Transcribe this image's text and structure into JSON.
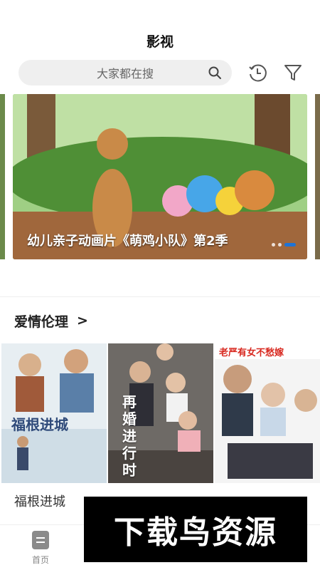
{
  "header": {
    "title": "影视"
  },
  "search": {
    "placeholder": "大家都在搜"
  },
  "banner": {
    "caption": "幼儿亲子动画片《萌鸡小队》第2季",
    "page_count": 3,
    "active_index": 2
  },
  "section": {
    "title": "爱情伦理",
    "arrow": ">"
  },
  "posters": [
    {
      "title": "福根进城",
      "art_text": "福根进城"
    },
    {
      "title": "",
      "art_text": "再婚进行时"
    },
    {
      "title": "",
      "art_text": "老严有女不愁嫁"
    }
  ],
  "bottom_nav": {
    "items": [
      {
        "label": "首页",
        "active": false
      },
      {
        "label": "",
        "active": false
      },
      {
        "label": "",
        "active": true
      },
      {
        "label": "",
        "active": false
      }
    ]
  },
  "watermark": {
    "text": "下载鸟资源"
  },
  "colors": {
    "accent": "#1e73d6"
  }
}
